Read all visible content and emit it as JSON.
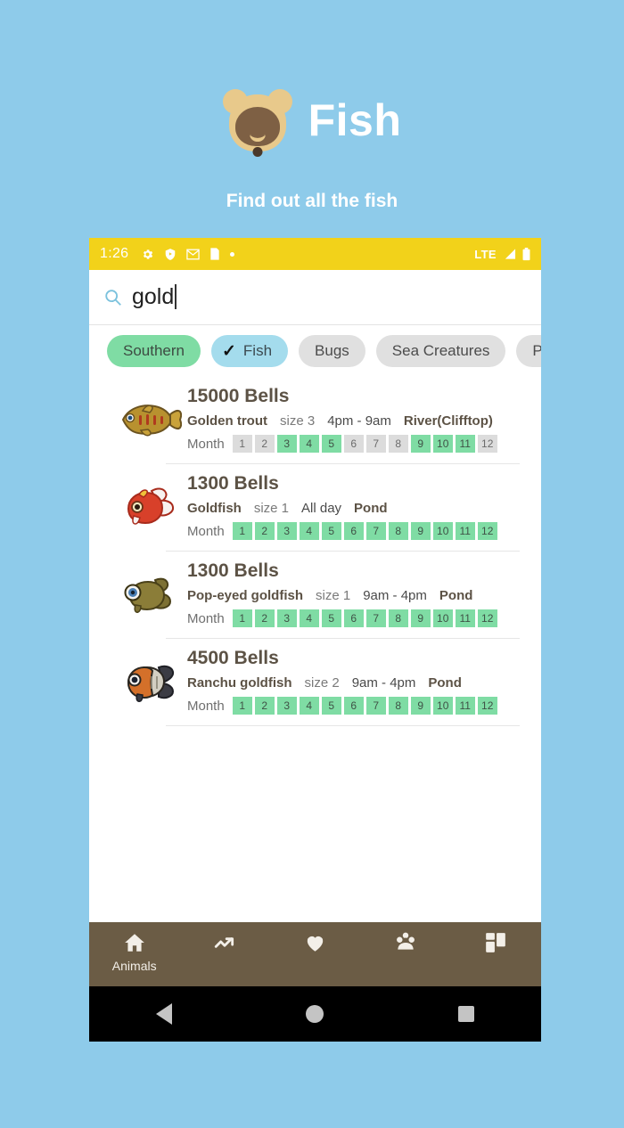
{
  "promo": {
    "title": "Fish",
    "subtitle": "Find out all the fish",
    "icon": "tanuki-face-icon",
    "background_color": "#8ecbea"
  },
  "statusbar": {
    "time": "1:26",
    "background_color": "#f2d21a",
    "left_icons": [
      "gear-icon",
      "play-protect-shield-icon",
      "gmail-icon",
      "app-icon",
      "dot-icon"
    ],
    "network": "LTE",
    "right_icons": [
      "signal-icon",
      "battery-icon"
    ]
  },
  "search": {
    "icon": "search-icon",
    "value": "gold",
    "placeholder": "Search"
  },
  "filters": [
    {
      "label": "Southern",
      "state": "active-green",
      "checked": false
    },
    {
      "label": "Fish",
      "state": "active-blue",
      "checked": true
    },
    {
      "label": "Bugs",
      "state": "inactive",
      "checked": false
    },
    {
      "label": "Sea Creatures",
      "state": "inactive",
      "checked": false
    },
    {
      "label": "Pric",
      "state": "inactive",
      "checked": false
    }
  ],
  "month_label": "Month",
  "months": [
    "1",
    "2",
    "3",
    "4",
    "5",
    "6",
    "7",
    "8",
    "9",
    "10",
    "11",
    "12"
  ],
  "results": [
    {
      "price": "15000 Bells",
      "name": "Golden trout",
      "size": "size 3",
      "time": "4pm - 9am",
      "location": "River(Clifftop)",
      "sprite": "golden-trout-sprite",
      "active_months": [
        3,
        4,
        5,
        9,
        10,
        11
      ]
    },
    {
      "price": "1300 Bells",
      "name": "Goldfish",
      "size": "size 1",
      "time": "All day",
      "location": "Pond",
      "sprite": "goldfish-sprite",
      "active_months": [
        1,
        2,
        3,
        4,
        5,
        6,
        7,
        8,
        9,
        10,
        11,
        12
      ]
    },
    {
      "price": "1300 Bells",
      "name": "Pop-eyed goldfish",
      "size": "size 1",
      "time": "9am - 4pm",
      "location": "Pond",
      "sprite": "pop-eyed-goldfish-sprite",
      "active_months": [
        1,
        2,
        3,
        4,
        5,
        6,
        7,
        8,
        9,
        10,
        11,
        12
      ]
    },
    {
      "price": "4500 Bells",
      "name": "Ranchu goldfish",
      "size": "size 2",
      "time": "9am - 4pm",
      "location": "Pond",
      "sprite": "ranchu-goldfish-sprite",
      "active_months": [
        1,
        2,
        3,
        4,
        5,
        6,
        7,
        8,
        9,
        10,
        11,
        12
      ]
    }
  ],
  "bottom_nav": {
    "background_color": "#6b5c45",
    "items": [
      {
        "icon": "home-icon",
        "label": "Animals",
        "active": true
      },
      {
        "icon": "trending-up-icon",
        "label": "",
        "active": false
      },
      {
        "icon": "heart-icon",
        "label": "",
        "active": false
      },
      {
        "icon": "flower-icon",
        "label": "",
        "active": false
      },
      {
        "icon": "dashboard-grid-icon",
        "label": "",
        "active": false
      }
    ]
  },
  "android_nav": {
    "back": "back-icon",
    "home": "home-circle-icon",
    "recents": "recents-square-icon"
  },
  "colors": {
    "accent_green": "#7fdca4",
    "accent_blue": "#a4dced",
    "inactive_gray": "#e0e0e0",
    "status_yellow": "#f2d21a",
    "nav_brown": "#6b5c45"
  }
}
